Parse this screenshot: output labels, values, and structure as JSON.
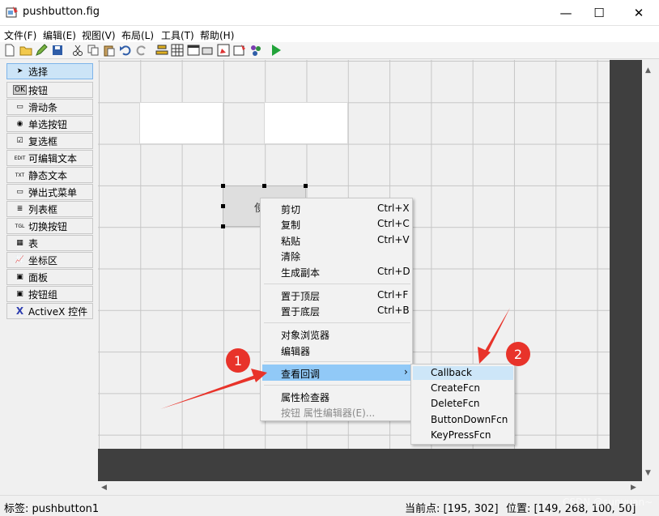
{
  "window": {
    "title": "pushbutton.fig",
    "minimize": "—",
    "maximize": "☐",
    "close": "✕"
  },
  "menu": [
    "文件(F)",
    "编辑(E)",
    "视图(V)",
    "布局(L)",
    "工具(T)",
    "帮助(H)"
  ],
  "palette": [
    {
      "label": "选择",
      "icon": "arrow-icon",
      "glyph": "➤"
    },
    {
      "label": "按钮",
      "icon": "pushbutton-icon",
      "glyph": "OK"
    },
    {
      "label": "滑动条",
      "icon": "slider-icon",
      "glyph": "▭"
    },
    {
      "label": "单选按钮",
      "icon": "radio-icon",
      "glyph": "◉"
    },
    {
      "label": "复选框",
      "icon": "checkbox-icon",
      "glyph": "☑"
    },
    {
      "label": "可编辑文本",
      "icon": "edit-text-icon",
      "glyph": "EDIT"
    },
    {
      "label": "静态文本",
      "icon": "static-text-icon",
      "glyph": "TXT"
    },
    {
      "label": "弹出式菜单",
      "icon": "popup-menu-icon",
      "glyph": "▭"
    },
    {
      "label": "列表框",
      "icon": "listbox-icon",
      "glyph": "≣"
    },
    {
      "label": "切换按钮",
      "icon": "toggle-icon",
      "glyph": "TGL"
    },
    {
      "label": "表",
      "icon": "table-icon",
      "glyph": "▦"
    },
    {
      "label": "坐标区",
      "icon": "axes-icon",
      "glyph": "📈"
    },
    {
      "label": "面板",
      "icon": "panel-icon",
      "glyph": "▣"
    },
    {
      "label": "按钮组",
      "icon": "button-group-icon",
      "glyph": "▣"
    },
    {
      "label": "ActiveX 控件",
      "icon": "activex-icon",
      "glyph": "X"
    }
  ],
  "button_text": "使",
  "context_menu": {
    "items": [
      {
        "label": "剪切",
        "shortcut": "Ctrl+X"
      },
      {
        "label": "复制",
        "shortcut": "Ctrl+C"
      },
      {
        "label": "粘贴",
        "shortcut": "Ctrl+V"
      },
      {
        "label": "清除",
        "shortcut": ""
      },
      {
        "label": "生成副本",
        "shortcut": "Ctrl+D"
      },
      {
        "label": "置于顶层",
        "shortcut": "Ctrl+F"
      },
      {
        "label": "置于底层",
        "shortcut": "Ctrl+B"
      },
      {
        "label": "对象浏览器",
        "shortcut": ""
      },
      {
        "label": "编辑器",
        "shortcut": ""
      },
      {
        "label": "查看回调",
        "shortcut": "›"
      },
      {
        "label": "属性检查器",
        "shortcut": ""
      },
      {
        "label": "按钮 属性编辑器(E)...",
        "shortcut": ""
      }
    ]
  },
  "submenu": [
    "Callback",
    "CreateFcn",
    "DeleteFcn",
    "ButtonDownFcn",
    "KeyPressFcn"
  ],
  "annotations": {
    "one": "1",
    "two": "2",
    "color": "#e8332a"
  },
  "status": {
    "tag": "标签: pushbutton1",
    "current_point": "当前点:  [195, 302]",
    "position": "位置:  [149, 268, 100, 50]"
  },
  "watermark": "CSDN @sunyuan~"
}
